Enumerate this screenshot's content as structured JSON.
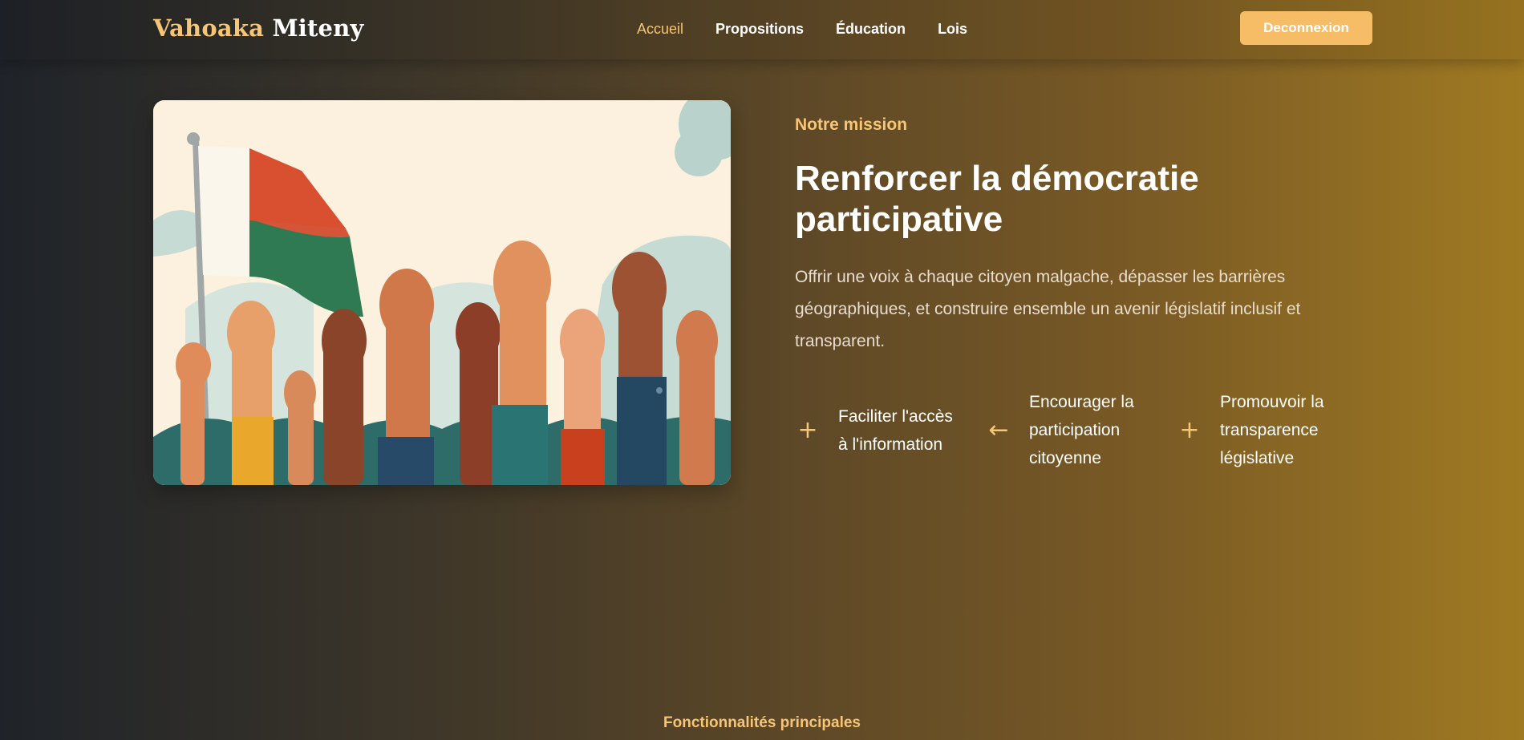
{
  "header": {
    "brand_part1": "Vahoaka",
    "brand_part2": "Miteny",
    "nav": [
      {
        "label": "Accueil",
        "active": true
      },
      {
        "label": "Propositions",
        "active": false
      },
      {
        "label": "Éducation",
        "active": false
      },
      {
        "label": "Lois",
        "active": false
      }
    ],
    "logout_label": "Deconnexion"
  },
  "mission": {
    "eyebrow": "Notre mission",
    "title": "Renforcer la démocratie participative",
    "description": "Offrir une voix à chaque citoyen malgache, dépasser les barrières géographiques, et construire ensemble un avenir législatif inclusif et transparent.",
    "features": [
      {
        "icon": "plus-icon",
        "glyph": "+",
        "label": "Faciliter l'accès\nà l'information"
      },
      {
        "icon": "arrow-left-icon",
        "glyph": "←",
        "label": "Encourager la\nparticipation\ncitoyenne"
      },
      {
        "icon": "plus-icon",
        "glyph": "+",
        "label": "Promouvoir la\ntransparence\nlégislative"
      }
    ]
  },
  "features_section": {
    "label": "Fonctionnalités principales"
  },
  "colors": {
    "accent": "#f6c575",
    "button": "#f6bd66",
    "bg_left": "#1f2329",
    "bg_right": "#a07a22"
  }
}
